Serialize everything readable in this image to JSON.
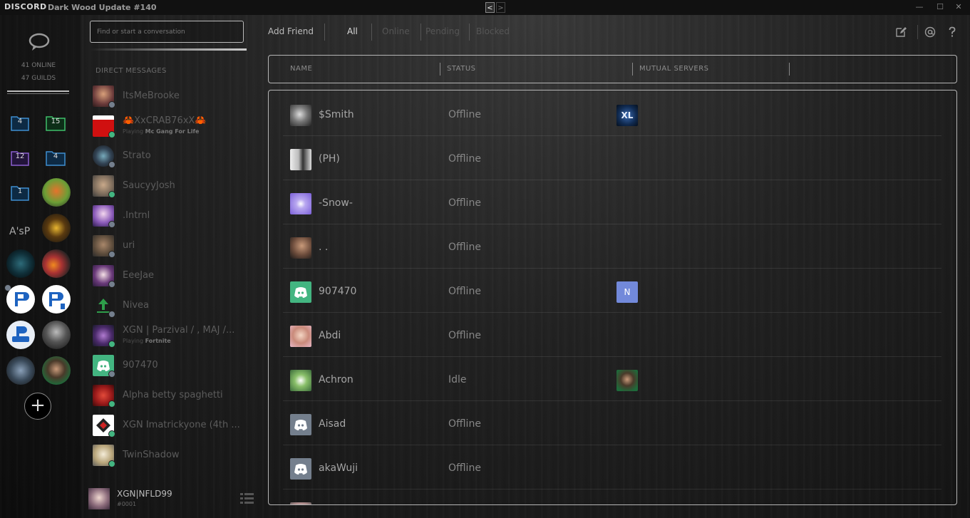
{
  "window": {
    "brand": "DISCORD",
    "title": "Dark Wood Update #140",
    "nav_back": "<",
    "nav_forward": ">",
    "minimize": "—",
    "maximize": "☐",
    "close": "✕"
  },
  "guilds": {
    "online": "41 ONLINE",
    "guild_count": "47 GUILDS",
    "folders": [
      "4",
      "15",
      "12",
      "4",
      "1"
    ],
    "text_guild": "A'sP",
    "add_label": "+"
  },
  "dm": {
    "search_placeholder": "Find or start a conversation",
    "header": "DIRECT MESSAGES",
    "items": [
      {
        "name": "ItsMeBrooke",
        "status": "offline"
      },
      {
        "name": "🦀XxCRAB76xX🦀",
        "status": "online",
        "activity_prefix": "Playing ",
        "activity": "Mc Gang For Life"
      },
      {
        "name": "Strato",
        "status": "offline"
      },
      {
        "name": "SaucyyJosh",
        "status": "online"
      },
      {
        "name": ".Intrnl",
        "status": "offline"
      },
      {
        "name": "uri",
        "status": "offline"
      },
      {
        "name": "EeeJae",
        "status": "offline"
      },
      {
        "name": "Nivea",
        "status": "offline"
      },
      {
        "name": "XGN | Parzival / , MAJ /...",
        "status": "online",
        "activity_prefix": "Playing ",
        "activity": "Fortnite"
      },
      {
        "name": "907470",
        "status": "offline"
      },
      {
        "name": "Alpha betty spaghetti",
        "status": "online"
      },
      {
        "name": "XGN Imatrickyone (4th ...",
        "status": "online"
      },
      {
        "name": "TwinShadow",
        "status": "online"
      }
    ]
  },
  "user": {
    "name": "XGN|NFLD99",
    "tag": "#0001"
  },
  "topnav": {
    "add_friend": "Add Friend",
    "all": "All",
    "online": "Online",
    "pending": "Pending",
    "blocked": "Blocked"
  },
  "table": {
    "col_name": "NAME",
    "col_status": "STATUS",
    "col_mutual": "MUTUAL SERVERS"
  },
  "friends": [
    {
      "name": "$Smith",
      "status": "Offline",
      "mutual": "XL"
    },
    {
      "name": "(PH)",
      "status": "Offline",
      "mutual": ""
    },
    {
      "name": "-Snow-",
      "status": "Offline",
      "mutual": ""
    },
    {
      "name": ". .",
      "status": "Offline",
      "mutual": ""
    },
    {
      "name": "907470",
      "status": "Offline",
      "mutual": "N"
    },
    {
      "name": "Abdi",
      "status": "Offline",
      "mutual": ""
    },
    {
      "name": "Achron",
      "status": "Idle",
      "mutual": "avatar"
    },
    {
      "name": "Aisad",
      "status": "Offline",
      "mutual": ""
    },
    {
      "name": "akaWuji",
      "status": "Offline",
      "mutual": ""
    }
  ],
  "colors": {
    "online": "#43b581",
    "offline": "#747f8d",
    "discord_blurple": "#7289da",
    "folder_blue": "#3e8ed0",
    "folder_green": "#3fbf6a",
    "folder_purple": "#8b5fd0"
  }
}
